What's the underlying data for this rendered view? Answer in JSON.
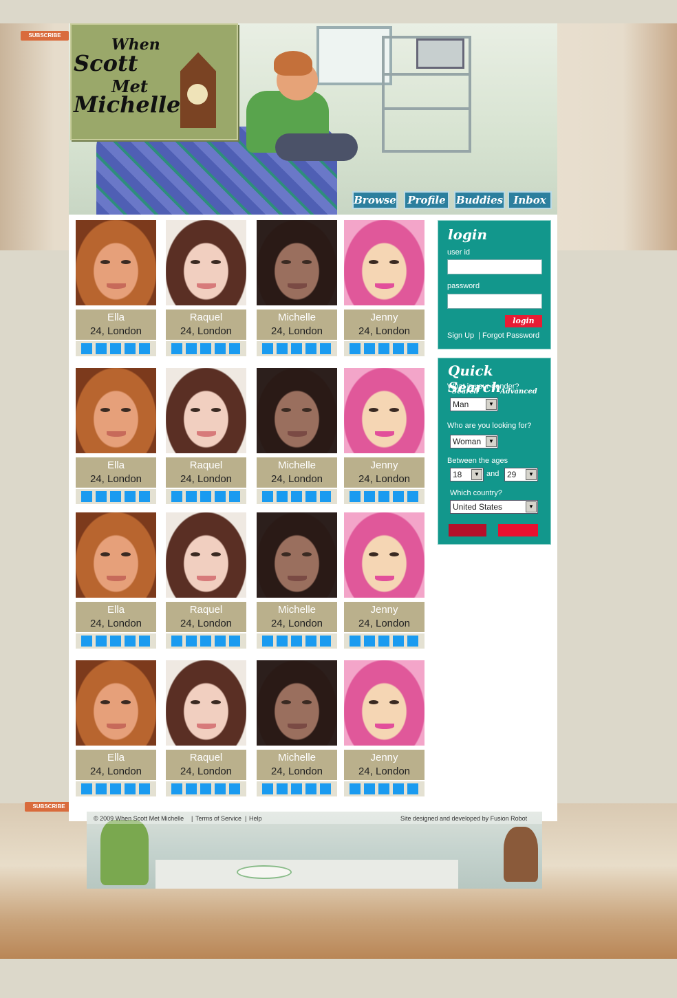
{
  "site": {
    "logo_lines": [
      "When",
      "Scott",
      "Met",
      "Michelle"
    ],
    "side_tag": "SUBSCRIBE"
  },
  "nav": [
    {
      "label": "Browse"
    },
    {
      "label": "Profile"
    },
    {
      "label": "Buddies"
    },
    {
      "label": "Inbox"
    }
  ],
  "profiles_rows": [
    [
      {
        "name": "Ella",
        "info": "24, London",
        "rating": 5
      },
      {
        "name": "Raquel",
        "info": "24, London",
        "rating": 5
      },
      {
        "name": "Michelle",
        "info": "24, London",
        "rating": 5
      },
      {
        "name": "Jenny",
        "info": "24, London",
        "rating": 5
      }
    ],
    [
      {
        "name": "Ella",
        "info": "24, London",
        "rating": 5
      },
      {
        "name": "Raquel",
        "info": "24, London",
        "rating": 5
      },
      {
        "name": "Michelle",
        "info": "24, London",
        "rating": 5
      },
      {
        "name": "Jenny",
        "info": "24, London",
        "rating": 5
      }
    ],
    [
      {
        "name": "Ella",
        "info": "24, London",
        "rating": 5
      },
      {
        "name": "Raquel",
        "info": "24, London",
        "rating": 5
      },
      {
        "name": "Michelle",
        "info": "24, London",
        "rating": 5
      },
      {
        "name": "Jenny",
        "info": "24, London",
        "rating": 5
      }
    ],
    [
      {
        "name": "Ella",
        "info": "24, London",
        "rating": 5
      },
      {
        "name": "Raquel",
        "info": "24, London",
        "rating": 5
      },
      {
        "name": "Michelle",
        "info": "24, London",
        "rating": 5
      },
      {
        "name": "Jenny",
        "info": "24, London",
        "rating": 5
      }
    ]
  ],
  "login": {
    "title": "login",
    "user_label": "user id",
    "user_value": "",
    "password_label": "password",
    "password_value": "",
    "button": "login",
    "signup": "Sign Up",
    "separator": "|",
    "forgot": "Forgot Password"
  },
  "quick_search": {
    "title": "Quick Search",
    "gender_q": "What is your gender?",
    "gender_value": "Man",
    "looking_q": "Who are you looking for?",
    "looking_value": "Woman",
    "ages_label": "Between the ages",
    "age_from": "18",
    "and_label": "and",
    "age_to": "29",
    "country_q": "Which country?",
    "country_value": "United States",
    "search_button": "Search",
    "advanced_button": "Advanced"
  },
  "footer": {
    "copyright": "© 2009 When Scott Met Michelle",
    "terms": "Terms of Service",
    "help": "Help",
    "sep": "|",
    "credit": "Site designed and developed by Fusion Robot"
  },
  "colors": {
    "teal_box": "#12978c",
    "nav_blue": "#2c7f9e",
    "caption_tan": "#bab08c",
    "rating_blue": "#1a9bf0",
    "login_red": "#e81c34",
    "search_red": "#b5102a",
    "advanced_red": "#e8102f"
  }
}
